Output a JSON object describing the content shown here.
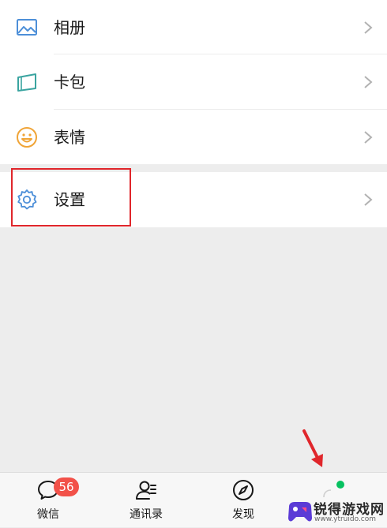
{
  "menu": {
    "items": [
      {
        "label": "相册",
        "icon": "album-icon"
      },
      {
        "label": "卡包",
        "icon": "card-pack-icon"
      },
      {
        "label": "表情",
        "icon": "sticker-smile-icon"
      },
      {
        "label": "设置",
        "icon": "gear-icon"
      }
    ]
  },
  "tabbar": {
    "tabs": [
      {
        "label": "微信",
        "icon": "chat-bubble-icon"
      },
      {
        "label": "通讯录",
        "icon": "contacts-icon"
      },
      {
        "label": "发现",
        "icon": "compass-icon"
      },
      {
        "label": "",
        "icon": "me-icon"
      }
    ],
    "chats_badge": "56"
  },
  "watermark": {
    "text": "锐得游戏网",
    "url": "www.ytruido.com"
  },
  "colors": {
    "accent_blue": "#4d8fd8",
    "smile_orange": "#f0a437",
    "badge_red": "#f25149",
    "highlight_red": "#e0262b",
    "tabbar_green_dot": "#07c160"
  }
}
